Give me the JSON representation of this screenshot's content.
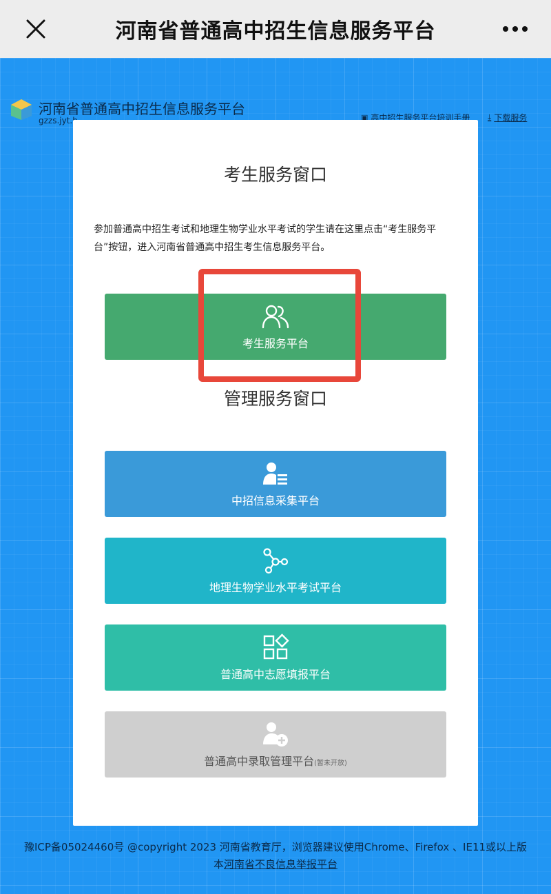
{
  "header": {
    "title": "河南省普通高中招生信息服务平台"
  },
  "site": {
    "name": "河南省普通高中招生信息服务平台",
    "url": "gzzs.jyt.h",
    "links": [
      {
        "label": "高中招生服务平台培训手册"
      },
      {
        "label": "下载服务"
      }
    ]
  },
  "student": {
    "title": "考生服务窗口",
    "description": "参加普通高中招生考试和地理生物学业水平考试的学生请在这里点击“考生服务平台”按钮，进入河南省普通高中招生考生信息服务平台。",
    "button": {
      "label": "考生服务平台",
      "icon": "users-icon",
      "color": "#45a96f"
    }
  },
  "management": {
    "title": "管理服务窗口",
    "buttons": [
      {
        "label": "中招信息采集平台",
        "icon": "user-list-icon",
        "color": "#3a9ad9"
      },
      {
        "label": "地理生物学业水平考试平台",
        "icon": "network-nodes-icon",
        "color": "#20b5c9"
      },
      {
        "label": "普通高中志愿填报平台",
        "icon": "grid-apps-icon",
        "color": "#2fbea7"
      },
      {
        "label": "普通高中录取管理平台",
        "note": "(暂未开放)",
        "icon": "user-add-icon",
        "color": "#cfcfcf"
      }
    ]
  },
  "footer": {
    "line1": "豫ICP备05024460号 @copyright 2023 河南省教育厅，浏览器建议使用Chrome、Firefox 、IE11或以上版",
    "line2_prefix": "本",
    "line2_link": "河南省不良信息举报平台"
  },
  "colors": {
    "background": "#2196f3",
    "highlight": "#e8473a"
  }
}
